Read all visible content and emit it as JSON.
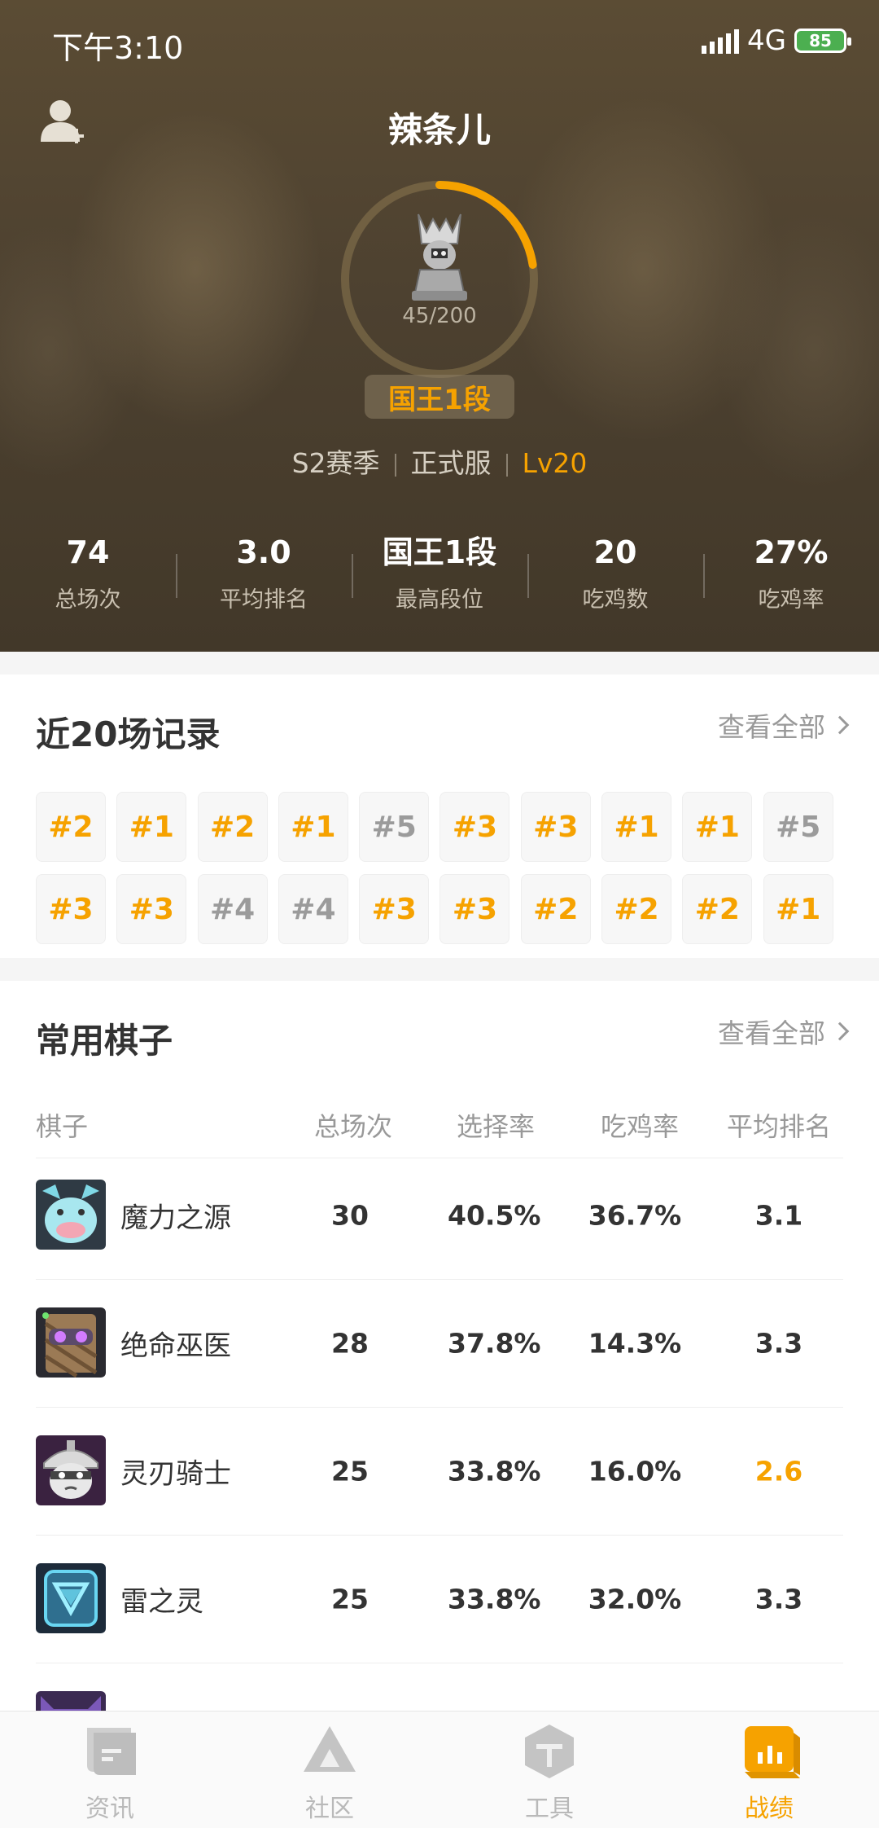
{
  "status_bar": {
    "time": "下午3:10",
    "network": "4G",
    "battery": "85"
  },
  "profile": {
    "name": "辣条儿",
    "rank_progress": "45/200",
    "rank_progress_value": 0.225,
    "rank_title": "国王1段",
    "season": "S2赛季",
    "server": "正式服",
    "level": "Lv20"
  },
  "stats": [
    {
      "value": "74",
      "label": "总场次"
    },
    {
      "value": "3.0",
      "label": "平均排名"
    },
    {
      "value": "国王1段",
      "label": "最高段位"
    },
    {
      "value": "20",
      "label": "吃鸡数"
    },
    {
      "value": "27%",
      "label": "吃鸡率"
    }
  ],
  "recent": {
    "title": "近20场记录",
    "view_all": "查看全部",
    "records": [
      "#2",
      "#1",
      "#2",
      "#1",
      "#5",
      "#3",
      "#3",
      "#1",
      "#1",
      "#5",
      "#3",
      "#3",
      "#4",
      "#4",
      "#3",
      "#3",
      "#2",
      "#2",
      "#2",
      "#1"
    ]
  },
  "pieces": {
    "title": "常用棋子",
    "view_all": "查看全部",
    "headers": {
      "name": "棋子",
      "games": "总场次",
      "pick_rate": "选择率",
      "win_rate": "吃鸡率",
      "avg_rank": "平均排名"
    },
    "rows": [
      {
        "name": "魔力之源",
        "games": "30",
        "pick_rate": "40.5%",
        "win_rate": "36.7%",
        "avg_rank": "3.1",
        "highlight": false,
        "icon": "mana-source-icon"
      },
      {
        "name": "绝命巫医",
        "games": "28",
        "pick_rate": "37.8%",
        "win_rate": "14.3%",
        "avg_rank": "3.3",
        "highlight": false,
        "icon": "witch-doctor-icon"
      },
      {
        "name": "灵刃骑士",
        "games": "25",
        "pick_rate": "33.8%",
        "win_rate": "16.0%",
        "avg_rank": "2.6",
        "highlight": true,
        "icon": "blade-knight-icon"
      },
      {
        "name": "雷之灵",
        "games": "25",
        "pick_rate": "33.8%",
        "win_rate": "32.0%",
        "avg_rank": "3.3",
        "highlight": false,
        "icon": "thunder-spirit-icon"
      }
    ]
  },
  "nav": [
    {
      "label": "资讯",
      "icon": "news-icon",
      "active": false
    },
    {
      "label": "社区",
      "icon": "community-icon",
      "active": false
    },
    {
      "label": "工具",
      "icon": "tools-icon",
      "active": false
    },
    {
      "label": "战绩",
      "icon": "records-icon",
      "active": true
    }
  ],
  "colors": {
    "accent": "#f6a200",
    "header_bg": "#4d4130",
    "inactive_nav": "#b9b9b9"
  }
}
